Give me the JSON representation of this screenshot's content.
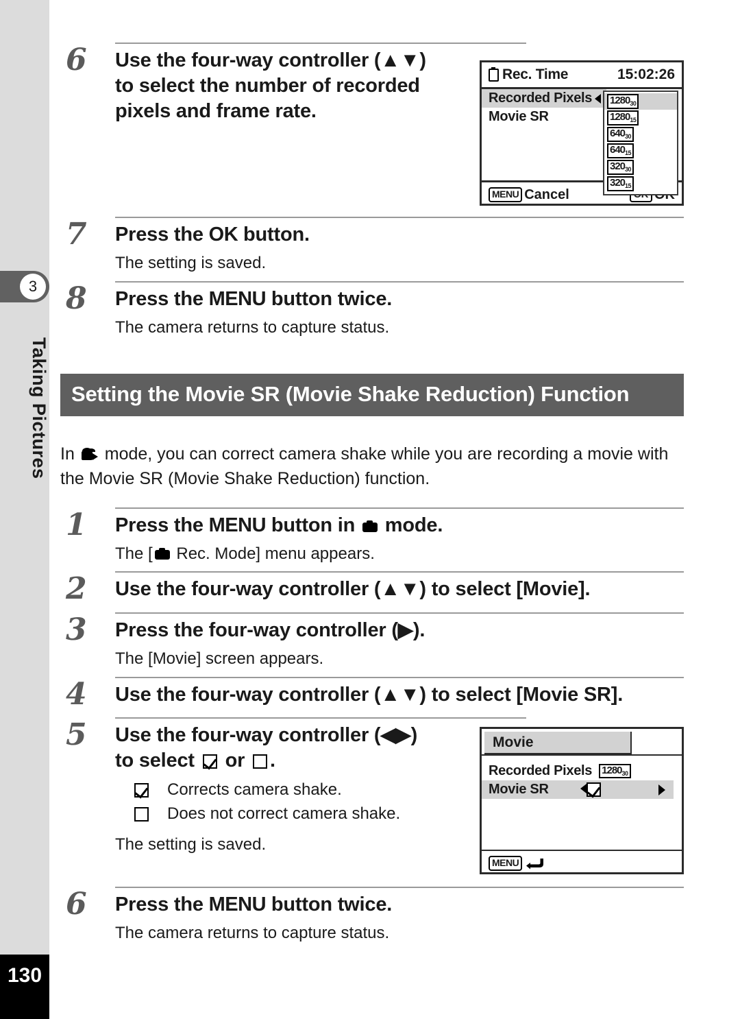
{
  "sidebar": {
    "chapter_number": "3",
    "chapter_title": "Taking Pictures",
    "page_number": "130"
  },
  "steps_top": [
    {
      "num": "6",
      "title_line1": "Use the four-way controller (▲▼)",
      "title_line2": "to select the number of recorded",
      "title_line3": "pixels and frame rate.",
      "desc": ""
    },
    {
      "num": "7",
      "title_a": "Press the ",
      "title_kbd": "OK",
      "title_b": " button.",
      "desc": "The setting is saved."
    },
    {
      "num": "8",
      "title_a": "Press the ",
      "title_kbd": "MENU",
      "title_b": " button twice.",
      "desc": "The camera returns to capture status."
    }
  ],
  "section": {
    "heading": "Setting the Movie SR (Movie Shake Reduction) Function",
    "intro_a": "In ",
    "intro_b": " mode, you can correct camera shake while you are recording a movie with the Movie SR (Movie Shake Reduction) function.",
    "heading_bg": "#5f5f5f"
  },
  "steps_bottom": [
    {
      "num": "1",
      "title_a": "Press the ",
      "title_kbd": "MENU",
      "title_b": " button in ",
      "title_c": " mode.",
      "desc_a": "The [",
      "desc_b": " Rec. Mode] menu appears."
    },
    {
      "num": "2",
      "title": "Use the four-way controller (▲▼) to select [Movie].",
      "desc": ""
    },
    {
      "num": "3",
      "title": "Press the four-way controller (▶).",
      "desc": "The [Movie] screen appears."
    },
    {
      "num": "4",
      "title": "Use the four-way controller (▲▼) to select [Movie SR].",
      "desc": ""
    },
    {
      "num": "5",
      "title_line1": "Use the four-way controller (◀▶)",
      "title_line2_a": "to select ",
      "title_line2_b": " or ",
      "title_line2_c": ".",
      "bullets": [
        {
          "mark": "checked",
          "text": "Corrects camera shake."
        },
        {
          "mark": "unchecked",
          "text": "Does not correct camera shake."
        }
      ],
      "desc": "The setting is saved."
    },
    {
      "num": "6",
      "title_a": "Press the ",
      "title_kbd": "MENU",
      "title_b": " button twice.",
      "desc": "The camera returns to capture status."
    }
  ],
  "lcd_rec_time": {
    "title": "Rec. Time",
    "time": "15:02:26",
    "rows": [
      {
        "label": "Recorded Pixels",
        "selected": true
      },
      {
        "label": "Movie SR",
        "selected": false
      }
    ],
    "resolution_options": [
      {
        "value": "1280",
        "fps": "30",
        "highlighted": true
      },
      {
        "value": "1280",
        "fps": "15",
        "highlighted": false
      },
      {
        "value": "640",
        "fps": "30",
        "highlighted": false
      },
      {
        "value": "640",
        "fps": "15",
        "highlighted": false
      },
      {
        "value": "320",
        "fps": "30",
        "highlighted": false
      },
      {
        "value": "320",
        "fps": "15",
        "highlighted": false
      }
    ],
    "footer_left_badge": "MENU",
    "footer_left_label": "Cancel",
    "footer_right_badge": "OK",
    "footer_right_label": "OK"
  },
  "lcd_movie": {
    "tab_label": "Movie",
    "rows": [
      {
        "label": "Recorded Pixels",
        "value": "1280",
        "fps": "30",
        "selected": false
      },
      {
        "label": "Movie SR",
        "value": "checked",
        "selected": true
      }
    ],
    "footer_badge": "MENU"
  }
}
